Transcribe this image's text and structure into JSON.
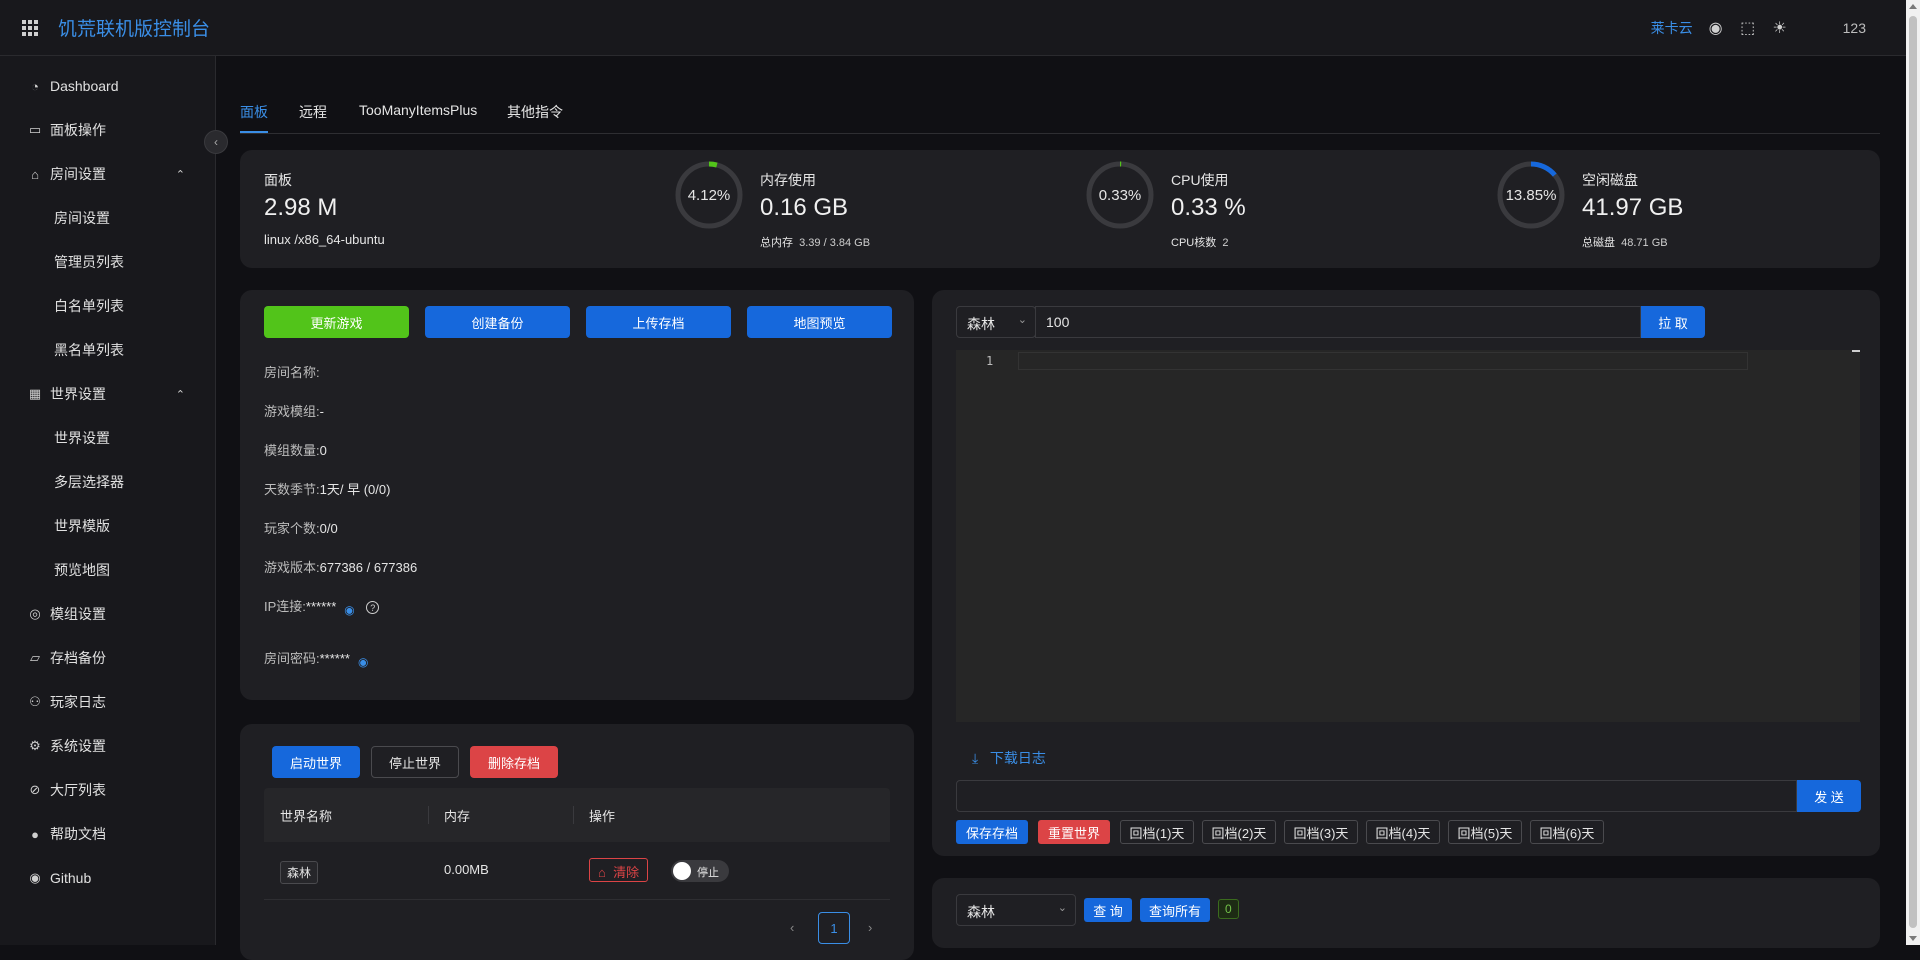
{
  "header": {
    "title": "饥荒联机版控制台",
    "link_text": "莱卡云",
    "user": "123"
  },
  "sidebar": {
    "items": [
      {
        "label": "Dashboard",
        "icon": "dashboard-icon"
      },
      {
        "label": "面板操作",
        "icon": "monitor-icon"
      },
      {
        "label": "房间设置",
        "icon": "home-icon",
        "expanded": true
      },
      {
        "label": "房间设置",
        "sub": true
      },
      {
        "label": "管理员列表",
        "sub": true
      },
      {
        "label": "白名单列表",
        "sub": true
      },
      {
        "label": "黑名单列表",
        "sub": true
      },
      {
        "label": "世界设置",
        "icon": "grid-icon",
        "expanded": true
      },
      {
        "label": "世界设置",
        "sub": true
      },
      {
        "label": "多层选择器",
        "sub": true
      },
      {
        "label": "世界模版",
        "sub": true
      },
      {
        "label": "预览地图",
        "sub": true
      },
      {
        "label": "模组设置",
        "icon": "globe-icon"
      },
      {
        "label": "存档备份",
        "icon": "folder-icon"
      },
      {
        "label": "玩家日志",
        "icon": "users-icon"
      },
      {
        "label": "系统设置",
        "icon": "gear-icon"
      },
      {
        "label": "大厅列表",
        "icon": "compass-icon"
      },
      {
        "label": "帮助文档",
        "icon": "help-icon"
      },
      {
        "label": "Github",
        "icon": "github-icon"
      }
    ]
  },
  "tabs": [
    "面板",
    "远程",
    "TooManyItemsPlus",
    "其他指令"
  ],
  "stats": {
    "panel": {
      "label": "面板",
      "value": "2.98 M",
      "sub": "linux /x86_64-ubuntu"
    },
    "memory": {
      "label": "内存使用",
      "value": "0.16 GB",
      "percent_text": "4.12%",
      "percent": 4.12,
      "sub_label": "总内存",
      "sub_value": "3.39 / 3.84 GB"
    },
    "cpu": {
      "label": "CPU使用",
      "value": "0.33 %",
      "percent_text": "0.33%",
      "percent": 0.33,
      "sub_label": "CPU核数",
      "sub_value": "2"
    },
    "disk": {
      "label": "空闲磁盘",
      "value": "41.97 GB",
      "percent_text": "13.85%",
      "percent": 13.85,
      "sub_label": "总磁盘",
      "sub_value": "48.71 GB"
    }
  },
  "room": {
    "buttons": {
      "update": "更新游戏",
      "backup": "创建备份",
      "upload": "上传存档",
      "map": "地图预览"
    },
    "rows": [
      {
        "label": "房间名称:",
        "value": ""
      },
      {
        "label": "游戏模组:",
        "value": "-"
      },
      {
        "label": "模组数量:",
        "value": "0"
      },
      {
        "label": "天数季节:",
        "value": "1天/ 早 (0/0)"
      },
      {
        "label": "玩家个数:",
        "value": "0/0"
      },
      {
        "label": "游戏版本:",
        "value": "677386 / 677386"
      },
      {
        "label": "IP连接:",
        "value": "******"
      },
      {
        "label": "房间密码:",
        "value": "******"
      }
    ]
  },
  "world": {
    "buttons": {
      "start": "启动世界",
      "stop": "停止世界",
      "delete": "删除存档"
    },
    "columns": [
      "世界名称",
      "内存",
      "操作"
    ],
    "rows": [
      {
        "name": "森林",
        "memory": "0.00MB",
        "clear": "清除",
        "switch": "停止"
      }
    ],
    "page": "1"
  },
  "log": {
    "world_select": "森林",
    "lines_input": "100",
    "fetch": "拉 取",
    "line_no": "1",
    "download": "下载日志",
    "send": "发 送",
    "quick": [
      "保存存档",
      "重置世界",
      "回档(1)天",
      "回档(2)天",
      "回档(3)天",
      "回档(4)天",
      "回档(5)天",
      "回档(6)天"
    ]
  },
  "player": {
    "world_select": "森林",
    "query": "查 询",
    "query_all": "查询所有",
    "count": "0"
  },
  "colors": {
    "accent": "#3a8ee6",
    "green": "#52c41a",
    "red": "#dc4446",
    "blue": "#1668dc"
  }
}
